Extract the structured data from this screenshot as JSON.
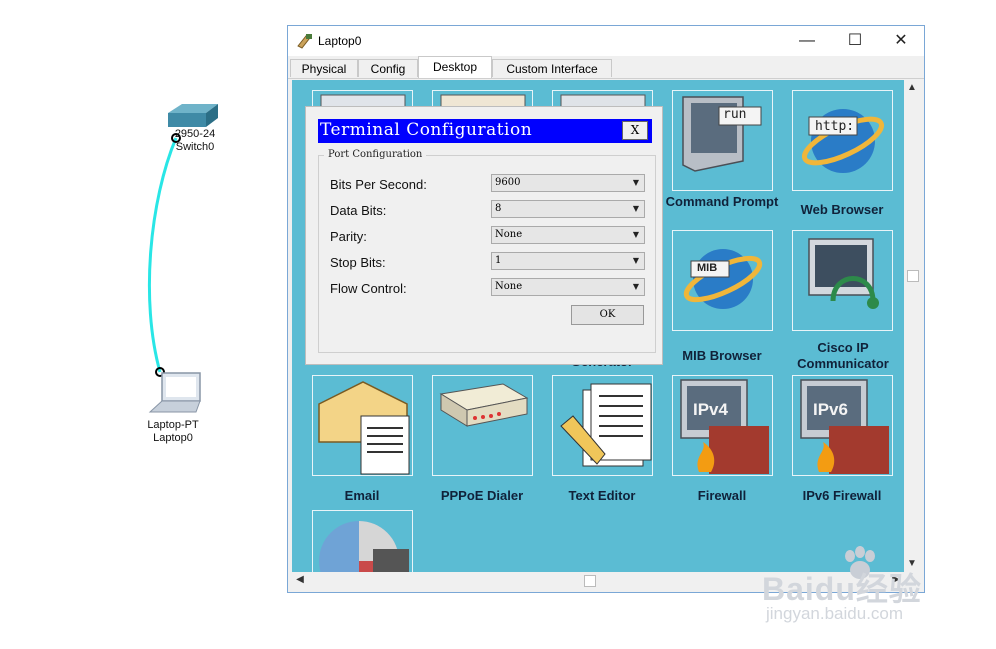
{
  "topology": {
    "switch": {
      "model": "2950-24",
      "name": "Switch0"
    },
    "laptop": {
      "model": "Laptop-PT",
      "name": "Laptop0"
    },
    "link_color": "#29e6e6"
  },
  "window": {
    "title": "Laptop0",
    "controls": {
      "minimize": "—",
      "maximize": "☐",
      "close": "✕"
    },
    "tabs": [
      "Physical",
      "Config",
      "Desktop",
      "Custom Interface"
    ],
    "active_tab": "Desktop"
  },
  "desktop": {
    "background": "#5bbcd3",
    "apps": {
      "command_prompt": "Command Prompt",
      "command_prompt_icon_text": "run",
      "web_browser": "Web Browser",
      "web_browser_icon_text": "http:",
      "mib_browser": "MIB Browser",
      "mib_icon_text": "MIB",
      "cisco_ip_communicator": "Cisco IP Communicator",
      "traffic_generator_partial": "Generator",
      "email": "Email",
      "pppoe_dialer": "PPPoE Dialer",
      "text_editor": "Text Editor",
      "firewall": "Firewall",
      "firewall_icon_text": "IPv4",
      "ipv6_firewall": "IPv6 Firewall",
      "ipv6_firewall_icon_text": "IPv6"
    }
  },
  "dialog": {
    "title": "Terminal Configuration",
    "close_label": "X",
    "group_label": "Port Configuration",
    "fields": [
      {
        "label": "Bits Per Second:",
        "value": "9600"
      },
      {
        "label": "Data Bits:",
        "value": "8"
      },
      {
        "label": "Parity:",
        "value": "None"
      },
      {
        "label": "Stop Bits:",
        "value": "1"
      },
      {
        "label": "Flow Control:",
        "value": "None"
      }
    ],
    "ok_label": "OK",
    "title_bar_color": "#0000ff"
  },
  "watermark": {
    "brand": "Baidu经验",
    "url": "jingyan.baidu.com"
  }
}
